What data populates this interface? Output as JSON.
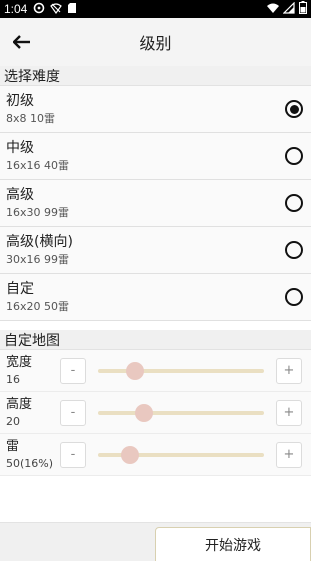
{
  "status_bar": {
    "time": "1:04"
  },
  "app_bar": {
    "title": "级别"
  },
  "difficulty": {
    "header": "选择难度",
    "levels": [
      {
        "name": "初级",
        "spec": "8x8  10雷",
        "selected": true
      },
      {
        "name": "中级",
        "spec": "16x16  40雷",
        "selected": false
      },
      {
        "name": "高级",
        "spec": "16x30  99雷",
        "selected": false
      },
      {
        "name": "高级(横向)",
        "spec": "30x16  99雷",
        "selected": false
      },
      {
        "name": "自定",
        "spec": "16x20  50雷",
        "selected": false
      }
    ]
  },
  "custom_map": {
    "header": "自定地图",
    "minus": "-",
    "plus": "+",
    "sliders": [
      {
        "label": "宽度",
        "value": "16",
        "position": 0.22
      },
      {
        "label": "高度",
        "value": "20",
        "position": 0.28
      },
      {
        "label": "雷",
        "value": "50(16%)",
        "position": 0.19
      }
    ]
  },
  "footer": {
    "start_label": "开始游戏"
  },
  "colors": {
    "track": "#eadfc2",
    "thumb": "#e9c8c0",
    "radio": "#111111"
  }
}
